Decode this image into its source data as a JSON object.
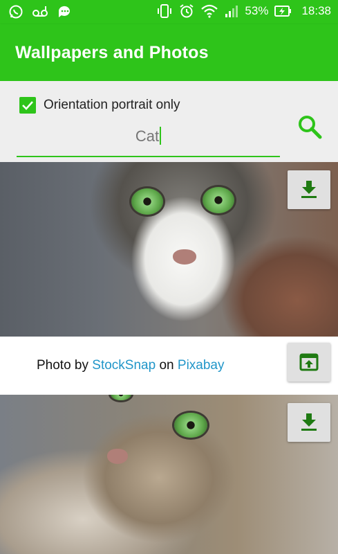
{
  "status_bar": {
    "battery": "53%",
    "time": "18:38",
    "left_icons": [
      "whatsapp-icon",
      "voicemail-icon",
      "chat-icon"
    ],
    "right_icons": [
      "vibrate-icon",
      "alarm-icon",
      "wifi-icon",
      "signal-icon",
      "battery-charging-icon"
    ]
  },
  "app_bar": {
    "title": "Wallpapers and Photos"
  },
  "filters": {
    "orientation_label": "Orientation portrait only",
    "orientation_checked": true,
    "search_value": "Cat",
    "search_icon": "search-icon"
  },
  "results": [
    {
      "download_icon": "download-icon",
      "credit": {
        "prefix": "Photo by ",
        "author": "StockSnap",
        "middle": " on ",
        "source": "Pixabay"
      },
      "open_icon": "open-in-browser-icon"
    },
    {
      "download_icon": "download-icon"
    }
  ],
  "colors": {
    "primary": "#2ec41a",
    "link": "#2196c9",
    "icon_dark_green": "#1f7a12"
  }
}
